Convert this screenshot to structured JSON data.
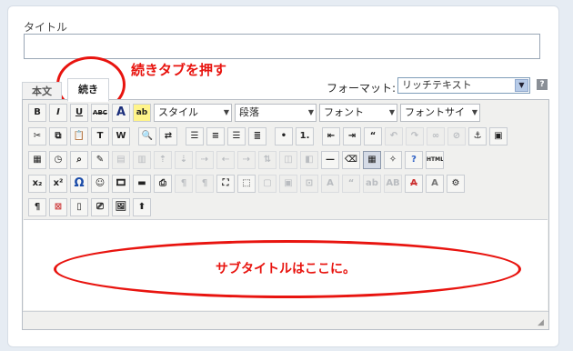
{
  "title_field": {
    "label": "タイトル",
    "value": ""
  },
  "annotations": {
    "tab_hint": "続きタブを押す",
    "content_hint": "サブタイトルはここに。",
    "color": "#e8140f"
  },
  "tabs": [
    {
      "label": "本文",
      "active": false
    },
    {
      "label": "続き",
      "active": true
    }
  ],
  "format": {
    "label": "フォーマット:",
    "value": "リッチテキスト",
    "help": "?"
  },
  "toolbar": {
    "style_select": "スタイル",
    "paragraph_select": "段落",
    "font_select": "フォント",
    "fontsize_select": "フォントサイ",
    "bold": "B",
    "italic": "I",
    "underline": "U",
    "strike": "ABC",
    "textcolor": "A",
    "html_button": "HTML",
    "omega": "Ω",
    "subscript": "x₂",
    "superscript": "x²",
    "pilcrow": "¶"
  },
  "editor": {
    "content": ""
  },
  "icons": {
    "help": "help-icon",
    "dropdown": "chevron-down-icon",
    "resize": "resize-grip-icon"
  }
}
